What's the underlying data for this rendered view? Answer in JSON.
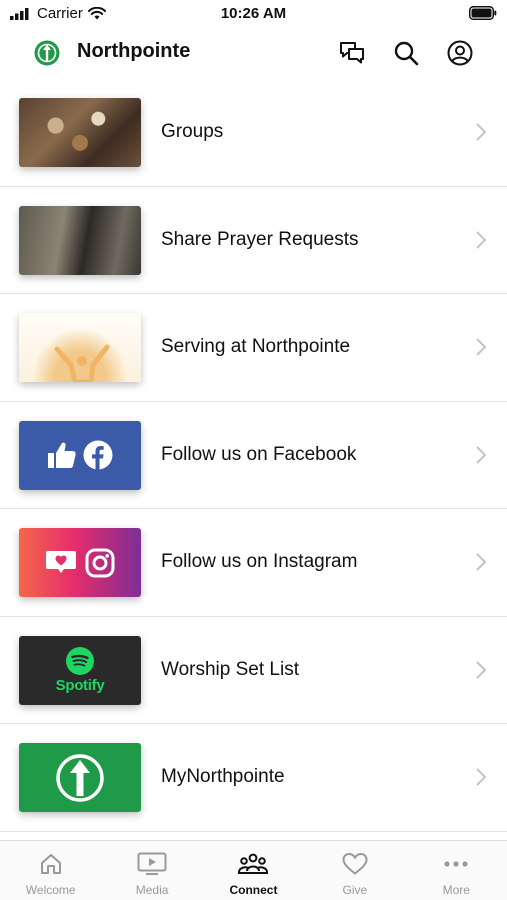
{
  "status_bar": {
    "carrier": "Carrier",
    "time": "10:26 AM"
  },
  "header": {
    "title": "Northpointe",
    "icons": [
      "chat-icon",
      "search-icon",
      "profile-icon"
    ]
  },
  "list": {
    "items": [
      {
        "label": "Groups",
        "thumb": "groups-photo"
      },
      {
        "label": "Share Prayer Requests",
        "thumb": "prayer-photo"
      },
      {
        "label": "Serving at Northpointe",
        "thumb": "serving-photo"
      },
      {
        "label": "Follow us on Facebook",
        "thumb": "facebook-graphic"
      },
      {
        "label": "Follow us on Instagram",
        "thumb": "instagram-graphic"
      },
      {
        "label": "Worship Set List",
        "thumb": "spotify-graphic"
      },
      {
        "label": "MyNorthpointe",
        "thumb": "mynorthpointe-graphic"
      }
    ],
    "spotify_wordmark": "Spotify"
  },
  "tabs": [
    {
      "label": "Welcome",
      "icon": "home-icon",
      "active": false
    },
    {
      "label": "Media",
      "icon": "media-icon",
      "active": false
    },
    {
      "label": "Connect",
      "icon": "people-icon",
      "active": true
    },
    {
      "label": "Give",
      "icon": "heart-icon",
      "active": false
    },
    {
      "label": "More",
      "icon": "more-icon",
      "active": false
    }
  ],
  "colors": {
    "brand_green": "#1f9a49",
    "facebook_blue": "#3b5aa8",
    "spotify_green": "#1ed760",
    "tab_inactive": "#999999"
  }
}
